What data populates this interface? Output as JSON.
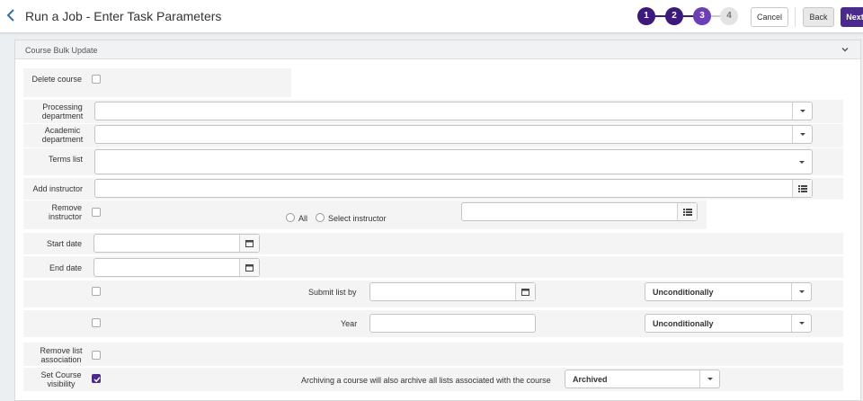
{
  "header": {
    "title": "Run a Job - Enter Task Parameters",
    "steps": [
      "1",
      "2",
      "3",
      "4"
    ],
    "cancel_label": "Cancel",
    "back_label": "Back",
    "next_label": "Next"
  },
  "panel": {
    "title": "Course Bulk Update"
  },
  "form": {
    "delete_course": {
      "label": "Delete course",
      "checked": false
    },
    "processing_department": {
      "label": "Processing department",
      "value": ""
    },
    "academic_department": {
      "label": "Academic department",
      "value": ""
    },
    "terms_list": {
      "label": "Terms list",
      "value": ""
    },
    "add_instructor": {
      "label": "Add instructor",
      "value": ""
    },
    "remove_instructor": {
      "label": "Remove instructor",
      "checked": false,
      "option_all": "All",
      "option_select": "Select instructor",
      "value": ""
    },
    "start_date": {
      "label": "Start date",
      "value": ""
    },
    "end_date": {
      "label": "End date",
      "value": ""
    },
    "submit_list_by": {
      "checked": false,
      "label": "Submit list by",
      "value": "",
      "condition": "Unconditionally"
    },
    "year": {
      "checked": false,
      "label": "Year",
      "value": "",
      "condition": "Unconditionally"
    },
    "remove_list_association": {
      "label": "Remove list association",
      "checked": false
    },
    "set_course_visibility": {
      "label": "Set Course visibility",
      "checked": true,
      "note": "Archiving a course will also archive all lists associated with the course",
      "value": "Archived"
    }
  },
  "colors": {
    "accent": "#4a2a8a",
    "step_done": "#3b1a7c",
    "step_current": "#6b3fb5",
    "link": "#3a6ea5"
  },
  "icons": {
    "back": "chevron-left-icon",
    "collapse": "chevron-down-icon",
    "calendar": "calendar-icon",
    "list": "list-icon"
  }
}
